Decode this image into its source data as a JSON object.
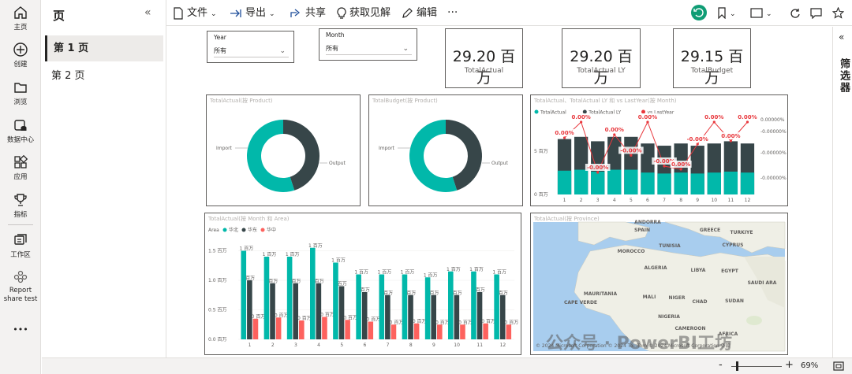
{
  "nav": [
    {
      "id": "home",
      "label": "主页",
      "icon": "home-icon"
    },
    {
      "id": "create",
      "label": "创建",
      "icon": "plus-circle-icon"
    },
    {
      "id": "browse",
      "label": "浏览",
      "icon": "folder-icon"
    },
    {
      "id": "datahub",
      "label": "数据中心",
      "icon": "database-icon"
    },
    {
      "id": "apps",
      "label": "应用",
      "icon": "apps-icon"
    },
    {
      "id": "metrics",
      "label": "指标",
      "icon": "trophy-icon"
    },
    {
      "id": "workspaces",
      "label": "工作区",
      "icon": "workspace-icon"
    },
    {
      "id": "report",
      "label": "Report share test",
      "icon": "report-icon"
    }
  ],
  "more_label": "•••",
  "pages": {
    "title": "页",
    "collapse": "«",
    "items": [
      {
        "label": "第 1 页",
        "active": true
      },
      {
        "label": "第 2 页",
        "active": false
      }
    ]
  },
  "toolbar": {
    "file": "文件",
    "export": "导出",
    "share": "共享",
    "insights": "获取见解",
    "edit": "编辑",
    "more": "···"
  },
  "filters_title": "筛选器",
  "filters_collapse": "«",
  "slicers": [
    {
      "label": "Year",
      "value": "所有"
    },
    {
      "label": "Month",
      "value": "所有"
    }
  ],
  "cards": [
    {
      "value": "29.20 百万",
      "label": "TotalActual"
    },
    {
      "value": "29.20 百万",
      "label": "TotalActual LY"
    },
    {
      "value": "29.15 百万",
      "label": "TotalBudget"
    }
  ],
  "donut1": {
    "title": "TotalActual(按 Product)",
    "labels": [
      "Import",
      "Output"
    ],
    "values": [
      45,
      55
    ],
    "colors": [
      "#374649",
      "#01b8aa"
    ]
  },
  "donut2": {
    "title": "TotalBudget(按 Product)",
    "labels": [
      "Import",
      "Output"
    ],
    "values": [
      45,
      55
    ],
    "colors": [
      "#374649",
      "#01b8aa"
    ]
  },
  "combo": {
    "title": "TotalActual、TotalActual LY 和 vs LastYear(按 Month)",
    "legend": [
      {
        "name": "TotalActual",
        "color": "#01b8aa"
      },
      {
        "name": "TotalActual LY",
        "color": "#374649"
      },
      {
        "name": "vs LastYear",
        "color": "#e8383d"
      }
    ],
    "y_left": [
      "5 百万",
      "0 百万"
    ],
    "y_right": [
      "0.00000%",
      "-0.00000%",
      "-0.00000%",
      "-0.00000%"
    ]
  },
  "chart_data": [
    {
      "type": "line",
      "title": "TotalActual、TotalActual LY 和 vs LastYear(按 Month)",
      "categories": [
        "1",
        "2",
        "3",
        "4",
        "5",
        "6",
        "7",
        "8",
        "9",
        "10",
        "11",
        "12"
      ],
      "series": [
        {
          "name": "TotalActual",
          "values": [
            2.5,
            2.6,
            2.4,
            2.6,
            2.6,
            2.3,
            2.2,
            2.3,
            2.2,
            2.3,
            2.4,
            2.3
          ]
        },
        {
          "name": "TotalActual LY",
          "values": [
            2.5,
            2.6,
            2.4,
            2.6,
            2.6,
            2.3,
            2.2,
            2.3,
            2.2,
            2.3,
            2.4,
            2.3
          ]
        },
        {
          "name": "vs LastYear",
          "values": [
            0,
            0,
            0,
            0,
            0,
            0,
            0,
            0,
            0,
            0,
            0,
            0
          ]
        }
      ],
      "point_labels": [
        "0.00%",
        "0.00%",
        "-0.00%",
        "0.00%",
        "-0.00%",
        "0.00%",
        "-0.00%",
        "0.00%",
        "-0.00%",
        "0.00%",
        "0.00%",
        "0.00%"
      ],
      "point_levels": [
        0.7,
        0.95,
        0.15,
        0.75,
        0.42,
        0.95,
        0.25,
        0.2,
        0.6,
        0.95,
        0.65,
        0.95
      ]
    },
    {
      "type": "bar",
      "title": "TotalActual(按 Month 和 Area)",
      "legend_title": "Area",
      "categories": [
        "1",
        "2",
        "3",
        "4",
        "5",
        "6",
        "7",
        "8",
        "9",
        "10",
        "11",
        "12"
      ],
      "ylim": [
        0,
        1.6
      ],
      "yticks": [
        "0.0 百万",
        "0.5 百万",
        "1.0 百万",
        "1.5 百万"
      ],
      "series": [
        {
          "name": "华北",
          "color": "#01b8aa",
          "values": [
            1.5,
            1.4,
            1.4,
            1.55,
            1.3,
            1.1,
            1.1,
            1.1,
            1.05,
            1.15,
            1.15,
            1.1
          ]
        },
        {
          "name": "华东",
          "color": "#374649",
          "values": [
            1.0,
            0.95,
            0.95,
            0.95,
            0.9,
            0.8,
            0.75,
            0.75,
            0.75,
            0.75,
            0.8,
            0.75
          ]
        },
        {
          "name": "华中",
          "color": "#fd625e",
          "values": [
            0.35,
            0.37,
            0.32,
            0.38,
            0.33,
            0.3,
            0.25,
            0.27,
            0.25,
            0.25,
            0.27,
            0.25
          ]
        }
      ],
      "bar_labels": [
        "1 百万",
        "百万",
        "0 百万"
      ]
    }
  ],
  "map": {
    "title": "TotalActual(按 Province)",
    "labels": [
      "ANDORRA",
      "SPAIN",
      "GREECE",
      "TURKIYE",
      "CYPRUS",
      "MOROCCO",
      "TUNISIA",
      "ALGERIA",
      "LIBYA",
      "EGYPT",
      "SAUDI ARA",
      "MAURITANIA",
      "MALI",
      "NIGER",
      "CHAD",
      "SUDAN",
      "CAPE VERDE",
      "AFRICA",
      "NIGERIA",
      "CAMEROON"
    ],
    "copyright": "© 2024 Microsoft Corporation © 2024 TomTom © 2024 Microsoft Corporation 条款"
  },
  "watermark": "公众号 · PowerBI工坊",
  "status": {
    "zoom": "69%",
    "minus": "-",
    "plus": "+"
  }
}
